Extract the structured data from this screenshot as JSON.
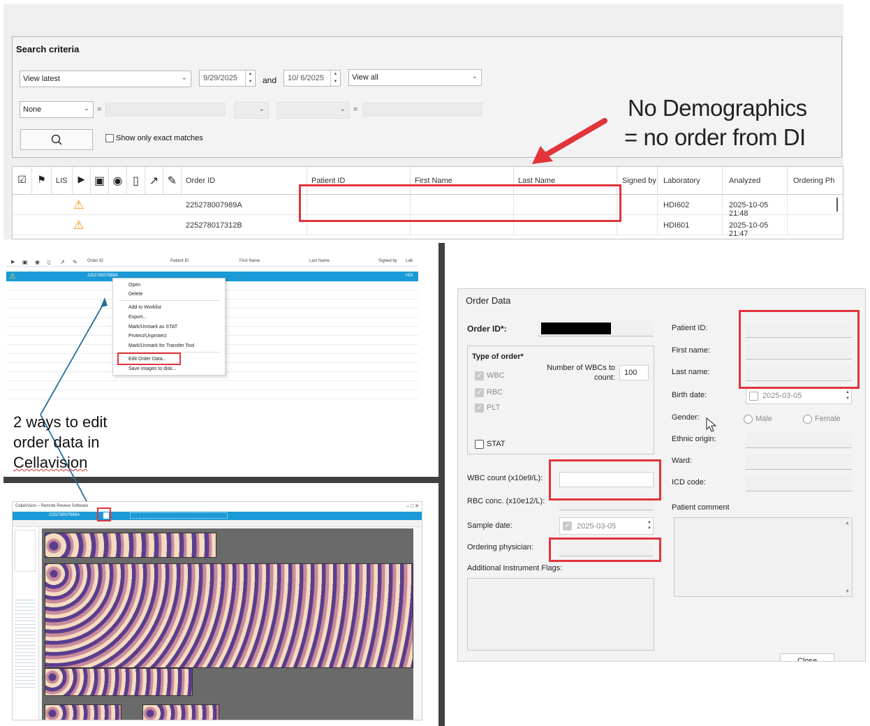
{
  "search": {
    "title": "Search criteria",
    "view_select": "View latest",
    "date_from": "9/29/2025",
    "and_label": "and",
    "date_to": "10/ 6/2025",
    "view_all_select": "View all",
    "field_select": "None",
    "eq1": "=",
    "eq2": "=",
    "exact_matches_label": "Show only exact matches"
  },
  "callout": {
    "line1": "No Demographics",
    "line2": "= no order from DI"
  },
  "grid": {
    "lis_header": "LIS",
    "columns": [
      "Order ID",
      "Patient ID",
      "First Name",
      "Last Name",
      "Signed by",
      "Laboratory",
      "Analyzed",
      "Ordering Ph"
    ],
    "rows": [
      {
        "order_id": "225278007989A",
        "patient_id": "",
        "first_name": "",
        "last_name": "",
        "signed_by": "",
        "laboratory": "HDI602",
        "analyzed": "2025-10-05 21:48"
      },
      {
        "order_id": "225278017312B",
        "patient_id": "",
        "first_name": "",
        "last_name": "",
        "signed_by": "",
        "laboratory": "HDI601",
        "analyzed": "2025-10-05 21:47"
      }
    ]
  },
  "mini_grid": {
    "columns": [
      "Order ID",
      "Patient ID",
      "First Name",
      "Last Name",
      "Signed by",
      "Lab"
    ],
    "selected_order": "225278007989A",
    "selected_lab": "HDI"
  },
  "context_menu": {
    "items": [
      "Open",
      "Delete",
      "Add to Worklist",
      "Export...",
      "Mark/Unmark as STAT",
      "Protect/Unprotect",
      "Mark/Unmark for Transfer Tool",
      "Edit Order Data...",
      "Save images to disk..."
    ]
  },
  "annotation": {
    "line1": "2 ways to edit",
    "line2": "order data in",
    "line3": "Cellavision"
  },
  "cv_window": {
    "title": "CellaVision – Remote Review Software",
    "order_id": "225278007989A"
  },
  "dialog": {
    "title": "Order Data",
    "order_id_label": "Order ID*:",
    "type_of_order_label": "Type of order*",
    "wbc_label": "WBC",
    "rbc_label": "RBC",
    "plt_label": "PLT",
    "num_wbcs_label_1": "Number of WBCs to",
    "num_wbcs_label_2": "count:",
    "num_wbcs_value": "100",
    "stat_label": "STAT",
    "wbc_count_label": "WBC count (x10e9/L):",
    "rbc_conc_label": "RBC conc. (x10e12/L):",
    "sample_date_label": "Sample date:",
    "sample_date_value": "2025-03-05",
    "ordering_physician_label": "Ordering physician:",
    "additional_flags_label": "Additional Instrument Flags:",
    "patient_id_label": "Patient ID:",
    "first_name_label": "First name:",
    "last_name_label": "Last name:",
    "birth_date_label": "Birth date:",
    "birth_date_value": "2025-03-05",
    "gender_label": "Gender:",
    "male_label": "Male",
    "female_label": "Female",
    "ethnic_origin_label": "Ethnic origin:",
    "ward_label": "Ward:",
    "icd_code_label": "ICD code:",
    "patient_comment_label": "Patient comment",
    "close_button": "Close"
  },
  "colors": {
    "highlight_red": "#e1343b",
    "arrow_blue": "#2a6f97",
    "warning_orange": "#ff8a00",
    "selection_blue": "#1a9ad6"
  }
}
